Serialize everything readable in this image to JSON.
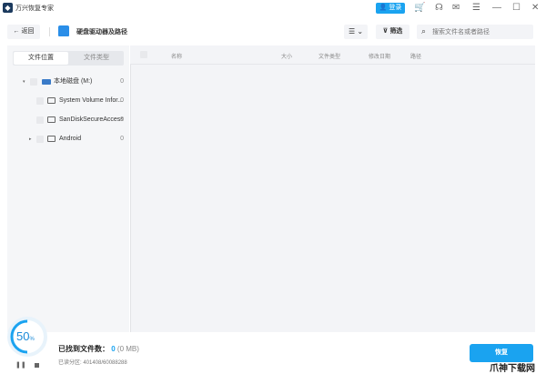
{
  "app": {
    "title": "万兴恢复专家",
    "login": "登录"
  },
  "toolbar": {
    "back": "返回",
    "heading": "硬盘驱动器及路径",
    "view": "☰ ⌄",
    "filter": "筛选",
    "search_placeholder": "搜索文件名或者路径"
  },
  "sidebar": {
    "tabs": [
      "文件位置",
      "文件类型"
    ],
    "tree": [
      {
        "label": "本地磁盘 (M:)",
        "count": "0"
      },
      {
        "label": "System Volume Infor...",
        "count": "0"
      },
      {
        "label": "SanDiskSecureAccess",
        "count": "0"
      },
      {
        "label": "Android",
        "count": "0"
      }
    ]
  },
  "table": {
    "columns": [
      "名称",
      "大小",
      "文件类型",
      "修改日期",
      "路径"
    ]
  },
  "status": {
    "progress_percent": 50,
    "progress_label": "50",
    "percent_sign": "%",
    "found_label": "已找到文件数：",
    "found_count": "0",
    "found_size": "(0 MB)",
    "partition": "已读分区: 401408/60088288"
  },
  "actions": {
    "recover": "恢复"
  },
  "watermark": "爪神下载网"
}
